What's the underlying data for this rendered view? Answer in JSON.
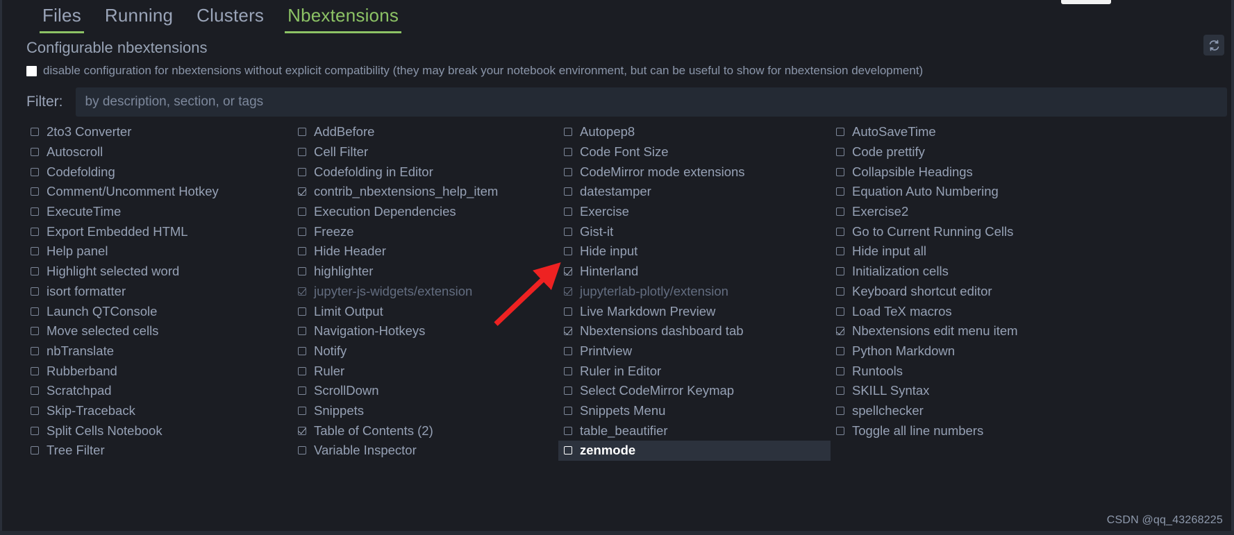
{
  "tabs": [
    {
      "label": "Files",
      "active": false,
      "underline": true
    },
    {
      "label": "Running",
      "active": false,
      "underline": false
    },
    {
      "label": "Clusters",
      "active": false,
      "underline": false
    },
    {
      "label": "Nbextensions",
      "active": true,
      "underline": true
    }
  ],
  "header": {
    "section_title": "Configurable nbextensions",
    "refresh_icon": "refresh-sync-icon"
  },
  "disable_option": {
    "checkbox_icon": "checkbox-filled-icon",
    "checked": true,
    "label": "disable configuration for nbextensions without explicit compatibility (they may break your notebook environment, but can be useful to show for nbextension development)"
  },
  "filter": {
    "label": "Filter:",
    "placeholder": "by description, section, or tags",
    "value": ""
  },
  "colors": {
    "accent_green": "#8cc265",
    "background": "#1b1d23",
    "input_background": "#242a34",
    "selected_background": "#2c323d",
    "text": "#96a1b5",
    "dim_text": "#636d80",
    "arrow_red": "#ee2222"
  },
  "columns": [
    {
      "items": [
        {
          "label": "2to3 Converter",
          "checked": false,
          "dim": false,
          "selected": false
        },
        {
          "label": "Autoscroll",
          "checked": false,
          "dim": false,
          "selected": false
        },
        {
          "label": "Codefolding",
          "checked": false,
          "dim": false,
          "selected": false
        },
        {
          "label": "Comment/Uncomment Hotkey",
          "checked": false,
          "dim": false,
          "selected": false
        },
        {
          "label": "ExecuteTime",
          "checked": false,
          "dim": false,
          "selected": false
        },
        {
          "label": "Export Embedded HTML",
          "checked": false,
          "dim": false,
          "selected": false
        },
        {
          "label": "Help panel",
          "checked": false,
          "dim": false,
          "selected": false
        },
        {
          "label": "Highlight selected word",
          "checked": false,
          "dim": false,
          "selected": false
        },
        {
          "label": "isort formatter",
          "checked": false,
          "dim": false,
          "selected": false
        },
        {
          "label": "Launch QTConsole",
          "checked": false,
          "dim": false,
          "selected": false
        },
        {
          "label": "Move selected cells",
          "checked": false,
          "dim": false,
          "selected": false
        },
        {
          "label": "nbTranslate",
          "checked": false,
          "dim": false,
          "selected": false
        },
        {
          "label": "Rubberband",
          "checked": false,
          "dim": false,
          "selected": false
        },
        {
          "label": "Scratchpad",
          "checked": false,
          "dim": false,
          "selected": false
        },
        {
          "label": "Skip-Traceback",
          "checked": false,
          "dim": false,
          "selected": false
        },
        {
          "label": "Split Cells Notebook",
          "checked": false,
          "dim": false,
          "selected": false
        },
        {
          "label": "Tree Filter",
          "checked": false,
          "dim": false,
          "selected": false
        }
      ]
    },
    {
      "items": [
        {
          "label": "AddBefore",
          "checked": false,
          "dim": false,
          "selected": false
        },
        {
          "label": "Cell Filter",
          "checked": false,
          "dim": false,
          "selected": false
        },
        {
          "label": "Codefolding in Editor",
          "checked": false,
          "dim": false,
          "selected": false
        },
        {
          "label": "contrib_nbextensions_help_item",
          "checked": true,
          "dim": false,
          "selected": false
        },
        {
          "label": "Execution Dependencies",
          "checked": false,
          "dim": false,
          "selected": false
        },
        {
          "label": "Freeze",
          "checked": false,
          "dim": false,
          "selected": false
        },
        {
          "label": "Hide Header",
          "checked": false,
          "dim": false,
          "selected": false
        },
        {
          "label": "highlighter",
          "checked": false,
          "dim": false,
          "selected": false
        },
        {
          "label": "jupyter-js-widgets/extension",
          "checked": true,
          "dim": true,
          "selected": false
        },
        {
          "label": "Limit Output",
          "checked": false,
          "dim": false,
          "selected": false
        },
        {
          "label": "Navigation-Hotkeys",
          "checked": false,
          "dim": false,
          "selected": false
        },
        {
          "label": "Notify",
          "checked": false,
          "dim": false,
          "selected": false
        },
        {
          "label": "Ruler",
          "checked": false,
          "dim": false,
          "selected": false
        },
        {
          "label": "ScrollDown",
          "checked": false,
          "dim": false,
          "selected": false
        },
        {
          "label": "Snippets",
          "checked": false,
          "dim": false,
          "selected": false
        },
        {
          "label": "Table of Contents (2)",
          "checked": true,
          "dim": false,
          "selected": false
        },
        {
          "label": "Variable Inspector",
          "checked": false,
          "dim": false,
          "selected": false
        }
      ]
    },
    {
      "items": [
        {
          "label": "Autopep8",
          "checked": false,
          "dim": false,
          "selected": false
        },
        {
          "label": "Code Font Size",
          "checked": false,
          "dim": false,
          "selected": false
        },
        {
          "label": "CodeMirror mode extensions",
          "checked": false,
          "dim": false,
          "selected": false
        },
        {
          "label": "datestamper",
          "checked": false,
          "dim": false,
          "selected": false
        },
        {
          "label": "Exercise",
          "checked": false,
          "dim": false,
          "selected": false
        },
        {
          "label": "Gist-it",
          "checked": false,
          "dim": false,
          "selected": false
        },
        {
          "label": "Hide input",
          "checked": false,
          "dim": false,
          "selected": false
        },
        {
          "label": "Hinterland",
          "checked": true,
          "dim": false,
          "selected": false
        },
        {
          "label": "jupyterlab-plotly/extension",
          "checked": true,
          "dim": true,
          "selected": false
        },
        {
          "label": "Live Markdown Preview",
          "checked": false,
          "dim": false,
          "selected": false
        },
        {
          "label": "Nbextensions dashboard tab",
          "checked": true,
          "dim": false,
          "selected": false
        },
        {
          "label": "Printview",
          "checked": false,
          "dim": false,
          "selected": false
        },
        {
          "label": "Ruler in Editor",
          "checked": false,
          "dim": false,
          "selected": false
        },
        {
          "label": "Select CodeMirror Keymap",
          "checked": false,
          "dim": false,
          "selected": false
        },
        {
          "label": "Snippets Menu",
          "checked": false,
          "dim": false,
          "selected": false
        },
        {
          "label": "table_beautifier",
          "checked": false,
          "dim": false,
          "selected": false
        },
        {
          "label": "zenmode",
          "checked": false,
          "dim": false,
          "selected": true
        }
      ]
    },
    {
      "items": [
        {
          "label": "AutoSaveTime",
          "checked": false,
          "dim": false,
          "selected": false
        },
        {
          "label": "Code prettify",
          "checked": false,
          "dim": false,
          "selected": false
        },
        {
          "label": "Collapsible Headings",
          "checked": false,
          "dim": false,
          "selected": false
        },
        {
          "label": "Equation Auto Numbering",
          "checked": false,
          "dim": false,
          "selected": false
        },
        {
          "label": "Exercise2",
          "checked": false,
          "dim": false,
          "selected": false
        },
        {
          "label": "Go to Current Running Cells",
          "checked": false,
          "dim": false,
          "selected": false
        },
        {
          "label": "Hide input all",
          "checked": false,
          "dim": false,
          "selected": false
        },
        {
          "label": "Initialization cells",
          "checked": false,
          "dim": false,
          "selected": false
        },
        {
          "label": "Keyboard shortcut editor",
          "checked": false,
          "dim": false,
          "selected": false
        },
        {
          "label": "Load TeX macros",
          "checked": false,
          "dim": false,
          "selected": false
        },
        {
          "label": "Nbextensions edit menu item",
          "checked": true,
          "dim": false,
          "selected": false
        },
        {
          "label": "Python Markdown",
          "checked": false,
          "dim": false,
          "selected": false
        },
        {
          "label": "Runtools",
          "checked": false,
          "dim": false,
          "selected": false
        },
        {
          "label": "SKILL Syntax",
          "checked": false,
          "dim": false,
          "selected": false
        },
        {
          "label": "spellchecker",
          "checked": false,
          "dim": false,
          "selected": false
        },
        {
          "label": "Toggle all line numbers",
          "checked": false,
          "dim": false,
          "selected": false
        }
      ]
    }
  ],
  "annotation": {
    "arrow_icon": "red-arrow-pointer",
    "points_to": "Hinterland"
  },
  "watermark": "CSDN @qq_43268225"
}
